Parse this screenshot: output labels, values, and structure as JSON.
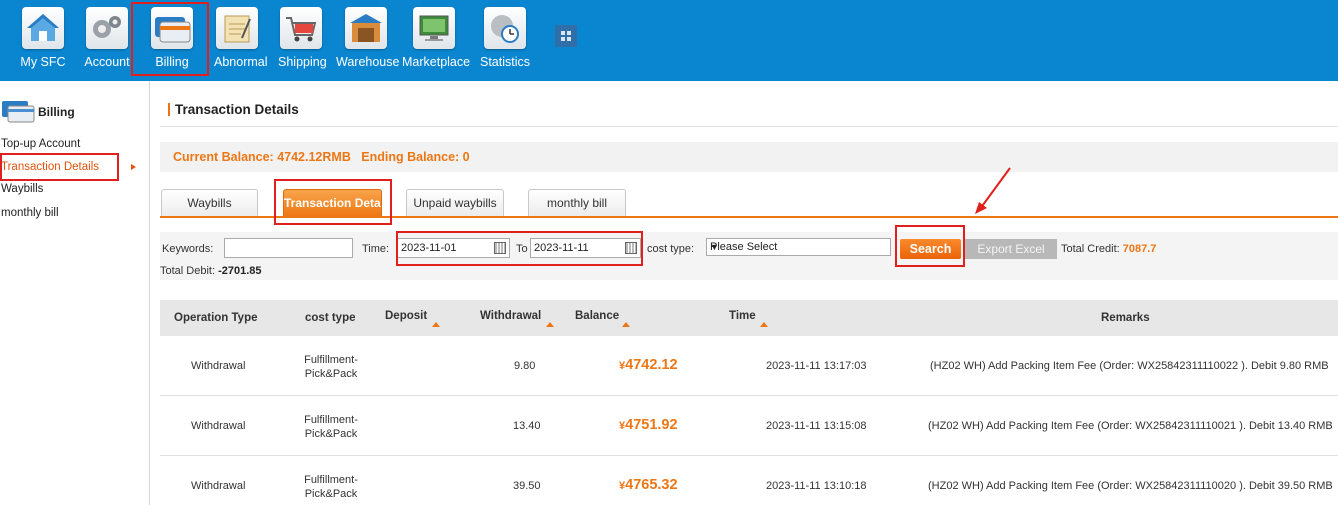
{
  "nav": {
    "items": [
      {
        "label": "My SFC",
        "icon": "house-icon"
      },
      {
        "label": "Account",
        "icon": "gears-icon"
      },
      {
        "label": "Billing",
        "icon": "credit-card-icon"
      },
      {
        "label": "Abnormal",
        "icon": "notepad-icon"
      },
      {
        "label": "Shipping",
        "icon": "cart-icon"
      },
      {
        "label": "Warehouse",
        "icon": "warehouse-icon"
      },
      {
        "label": "Marketplace",
        "icon": "monitor-icon"
      },
      {
        "label": "Statistics",
        "icon": "clock-chart-icon"
      }
    ]
  },
  "sidebar": {
    "title": "Billing",
    "items": [
      {
        "label": "Top-up Account"
      },
      {
        "label": "Transaction Details"
      },
      {
        "label": "Waybills"
      },
      {
        "label": "monthly bill"
      }
    ]
  },
  "page": {
    "title": "Transaction Details",
    "balance_text": "Current Balance: 4742.12RMB   Ending Balance: 0"
  },
  "tabs": [
    {
      "label": "Waybills"
    },
    {
      "label": "Transaction Details"
    },
    {
      "label": "Unpaid waybills"
    },
    {
      "label": "monthly bill"
    }
  ],
  "filters": {
    "keywords_label": "Keywords:",
    "keywords_value": "",
    "time_label": "Time:",
    "date_from": "2023-11-01",
    "to_label": "To",
    "date_to": "2023-11-11",
    "cost_type_label": "cost type:",
    "cost_type_value": "Please Select",
    "search_label": "Search",
    "export_label": "Export Excel",
    "total_credit_label": "Total Credit:",
    "total_credit_value": "7087.7",
    "total_debit_label": "Total Debit:",
    "total_debit_value": "-2701.85"
  },
  "table": {
    "headers": {
      "operation_type": "Operation Type",
      "cost_type": "cost type",
      "deposit": "Deposit",
      "withdrawal": "Withdrawal",
      "balance": "Balance",
      "time": "Time",
      "remarks": "Remarks"
    },
    "rows": [
      {
        "operation_type": "Withdrawal",
        "cost_type_1": "Fulfillment-",
        "cost_type_2": "Pick&Pack",
        "deposit": "",
        "withdrawal": "9.80",
        "currency": "¥",
        "balance": "4742.12",
        "time": "2023-11-11 13:17:03",
        "remarks": "(HZ02 WH) Add Packing Item Fee (Order: WX25842311110022 ). Debit 9.80 RMB"
      },
      {
        "operation_type": "Withdrawal",
        "cost_type_1": "Fulfillment-",
        "cost_type_2": "Pick&Pack",
        "deposit": "",
        "withdrawal": "13.40",
        "currency": "¥",
        "balance": "4751.92",
        "time": "2023-11-11 13:15:08",
        "remarks": "(HZ02 WH) Add Packing Item Fee (Order: WX25842311110021 ). Debit 13.40 RMB"
      },
      {
        "operation_type": "Withdrawal",
        "cost_type_1": "Fulfillment-",
        "cost_type_2": "Pick&Pack",
        "deposit": "",
        "withdrawal": "39.50",
        "currency": "¥",
        "balance": "4765.32",
        "time": "2023-11-11 13:10:18",
        "remarks": "(HZ02 WH) Add Packing Item Fee (Order: WX25842311110020 ). Debit 39.50 RMB"
      }
    ]
  },
  "colors": {
    "topbar": "#0a86d0",
    "accent": "#ee7715",
    "highlight_box": "#e0201c"
  }
}
